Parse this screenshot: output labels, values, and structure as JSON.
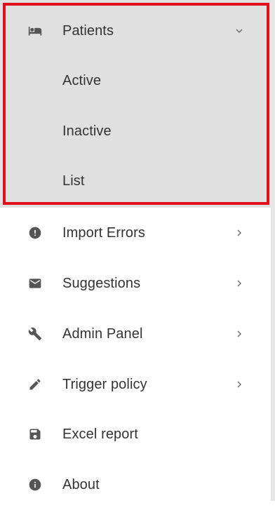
{
  "menu": {
    "patients": {
      "label": "Patients",
      "icon": "bed-icon",
      "expanded": true
    },
    "sub_items": [
      "Active",
      "Inactive",
      "List"
    ],
    "items": [
      {
        "label": "Import Errors",
        "icon": "alert-circle-icon",
        "has_submenu": true
      },
      {
        "label": "Suggestions",
        "icon": "mail-icon",
        "has_submenu": true
      },
      {
        "label": "Admin Panel",
        "icon": "wrench-icon",
        "has_submenu": true
      },
      {
        "label": "Trigger policy",
        "icon": "pencil-icon",
        "has_submenu": true
      },
      {
        "label": "Excel report",
        "icon": "save-icon",
        "has_submenu": false
      },
      {
        "label": "About",
        "icon": "info-icon",
        "has_submenu": false
      }
    ]
  },
  "colors": {
    "highlight_border": "#e0101a",
    "group_background": "#e0e0e0",
    "text": "#333333",
    "icon": "#555555"
  }
}
